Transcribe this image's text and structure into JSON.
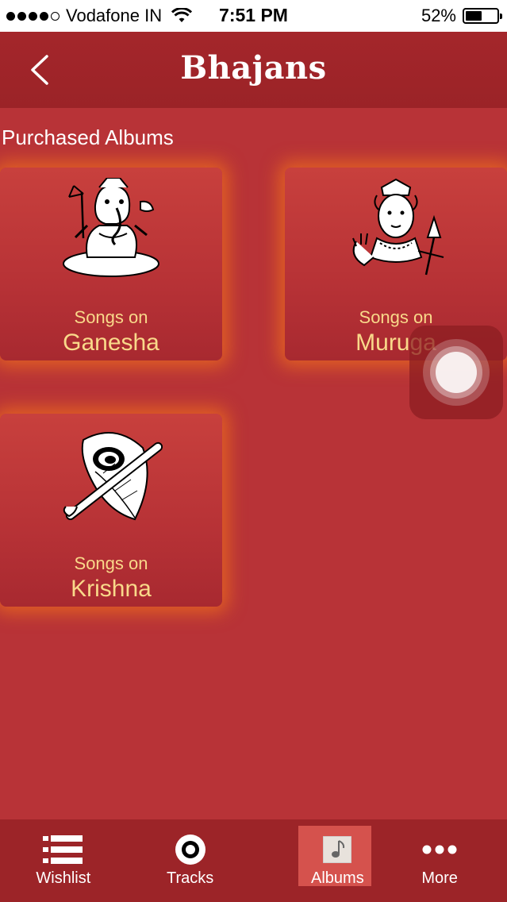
{
  "status_bar": {
    "carrier": "Vodafone IN",
    "time": "7:51 PM",
    "battery_percent_text": "52%",
    "battery_level": 0.52,
    "signal_bars_filled": 4,
    "signal_bars_total": 5
  },
  "nav": {
    "title": "Bhajans",
    "back_icon": "chevron-left-icon"
  },
  "section": {
    "title": "Purchased Albums"
  },
  "albums": [
    {
      "subtitle": "Songs on",
      "name": "Ganesha",
      "icon": "ganesha-illustration"
    },
    {
      "subtitle": "Songs on",
      "name": "Muruga",
      "icon": "muruga-illustration"
    },
    {
      "subtitle": "Songs on",
      "name": "Krishna",
      "icon": "flute-peacock-feather-illustration"
    }
  ],
  "tabs": [
    {
      "label": "Wishlist",
      "icon": "list-icon",
      "active": false
    },
    {
      "label": "Tracks",
      "icon": "disc-icon",
      "active": false
    },
    {
      "label": "Albums",
      "icon": "music-note-icon",
      "active": true
    },
    {
      "label": "More",
      "icon": "more-dots-icon",
      "active": false
    }
  ],
  "colors": {
    "background": "#b83337",
    "nav_bar": "#a4262b",
    "tab_bar": "#9c2428",
    "album_text": "#f9d98a",
    "card_glow": "#ee6e1e",
    "active_tab": "#d5524d"
  }
}
